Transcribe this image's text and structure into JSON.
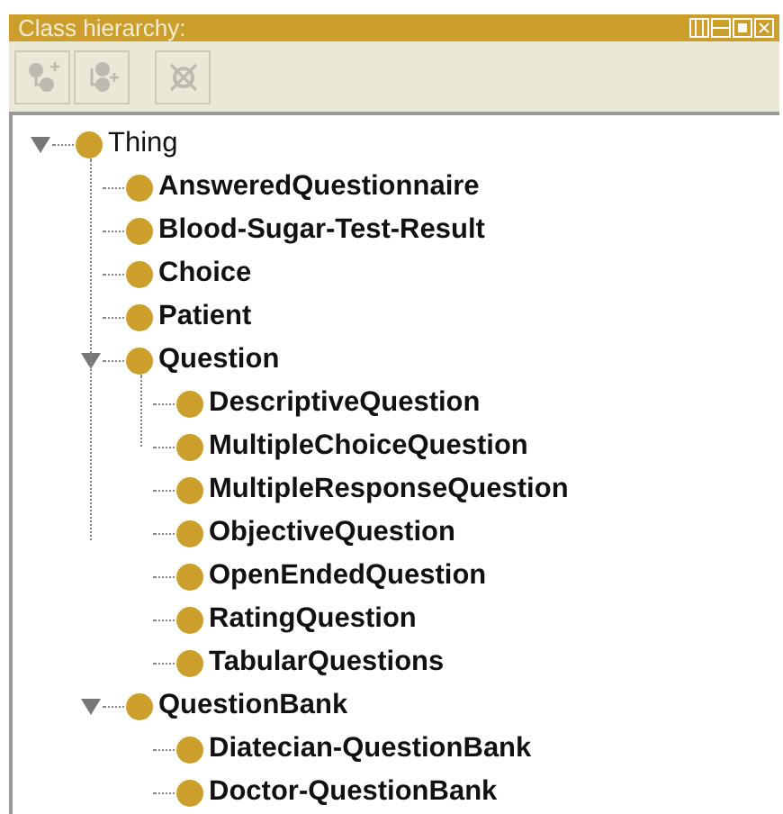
{
  "panel": {
    "title": "Class hierarchy:"
  },
  "toolbar": [
    {
      "kind": "add-subclass",
      "disabled": true
    },
    {
      "kind": "add-sibling",
      "disabled": true
    },
    {
      "kind": "delete",
      "disabled": true
    }
  ],
  "tree": [
    {
      "label": "Thing",
      "bold": false,
      "expanded": true,
      "children": [
        {
          "label": "AnsweredQuestionnaire",
          "bold": true
        },
        {
          "label": "Blood-Sugar-Test-Result",
          "bold": true
        },
        {
          "label": "Choice",
          "bold": true
        },
        {
          "label": "Patient",
          "bold": true
        },
        {
          "label": "Question",
          "bold": true,
          "expanded": true,
          "children": [
            {
              "label": "DescriptiveQuestion",
              "bold": true
            },
            {
              "label": "MultipleChoiceQuestion",
              "bold": true
            },
            {
              "label": "MultipleResponseQuestion",
              "bold": true
            },
            {
              "label": "ObjectiveQuestion",
              "bold": true
            },
            {
              "label": "OpenEndedQuestion",
              "bold": true
            },
            {
              "label": "RatingQuestion",
              "bold": true
            },
            {
              "label": "TabularQuestions",
              "bold": true
            }
          ]
        },
        {
          "label": "QuestionBank",
          "bold": true,
          "expanded": true,
          "children": [
            {
              "label": "Diatecian-QuestionBank",
              "bold": true
            },
            {
              "label": "Doctor-QuestionBank",
              "bold": true
            }
          ]
        }
      ]
    }
  ]
}
